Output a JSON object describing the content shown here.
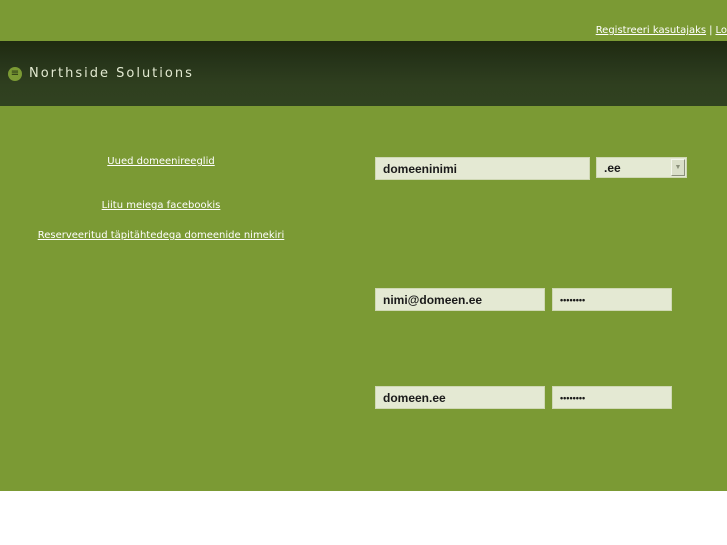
{
  "top_links": {
    "register": "Registreeri kasutajaks",
    "separator": "|",
    "login": "Lo"
  },
  "header": {
    "brand": "Northside Solutions",
    "logo_icon": "≡"
  },
  "left_links": [
    "Uued domeenireeglid",
    "Liitu meiega facebookis",
    "Reserveeritud täpitähtedega domeenide nimekiri"
  ],
  "domain_search": {
    "name_value": "domeeninimi",
    "tld_selected": ".ee",
    "dropdown_icon": "▼"
  },
  "email_login": {
    "email_value": "nimi@domeen.ee",
    "password_value": "••••••••"
  },
  "domain_login": {
    "domain_value": "domeen.ee",
    "password_value": "••••••••"
  },
  "colors": {
    "stage_bg": "#7b9a34",
    "header_bg": "#27351a",
    "field_bg": "#e4e9d3"
  }
}
